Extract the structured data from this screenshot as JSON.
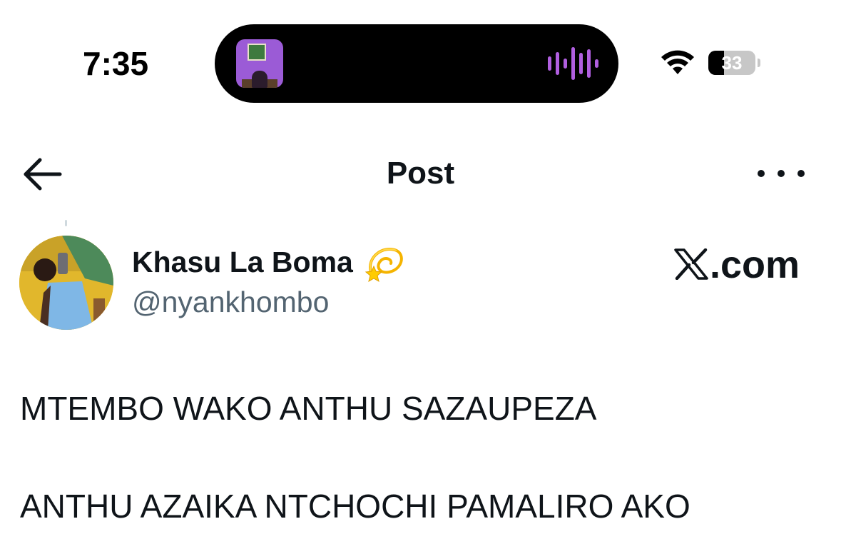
{
  "status_bar": {
    "time": "7:35",
    "battery_level": "33",
    "battery_fraction": 0.33,
    "icons": [
      "wifi-icon",
      "battery-icon",
      "audio-waveform-icon"
    ],
    "waveform_color": "#b15fe0"
  },
  "nav": {
    "title": "Post",
    "back_icon": "arrow-left-icon",
    "more_icon": "more-horizontal-icon"
  },
  "post": {
    "author": {
      "display_name": "Khasu La Boma",
      "name_emoji": "💫",
      "handle": "@nyankhombo"
    },
    "watermark": "X.com",
    "watermark_text": ".com",
    "lines": [
      "MTEMBO WAKO ANTHU SAZAUPEZA",
      "ANTHU AZAIKA NTCHOCHI PAMALIRO AKO"
    ]
  },
  "colors": {
    "text_primary": "#0f1419",
    "text_secondary": "#536471",
    "background": "#ffffff"
  }
}
